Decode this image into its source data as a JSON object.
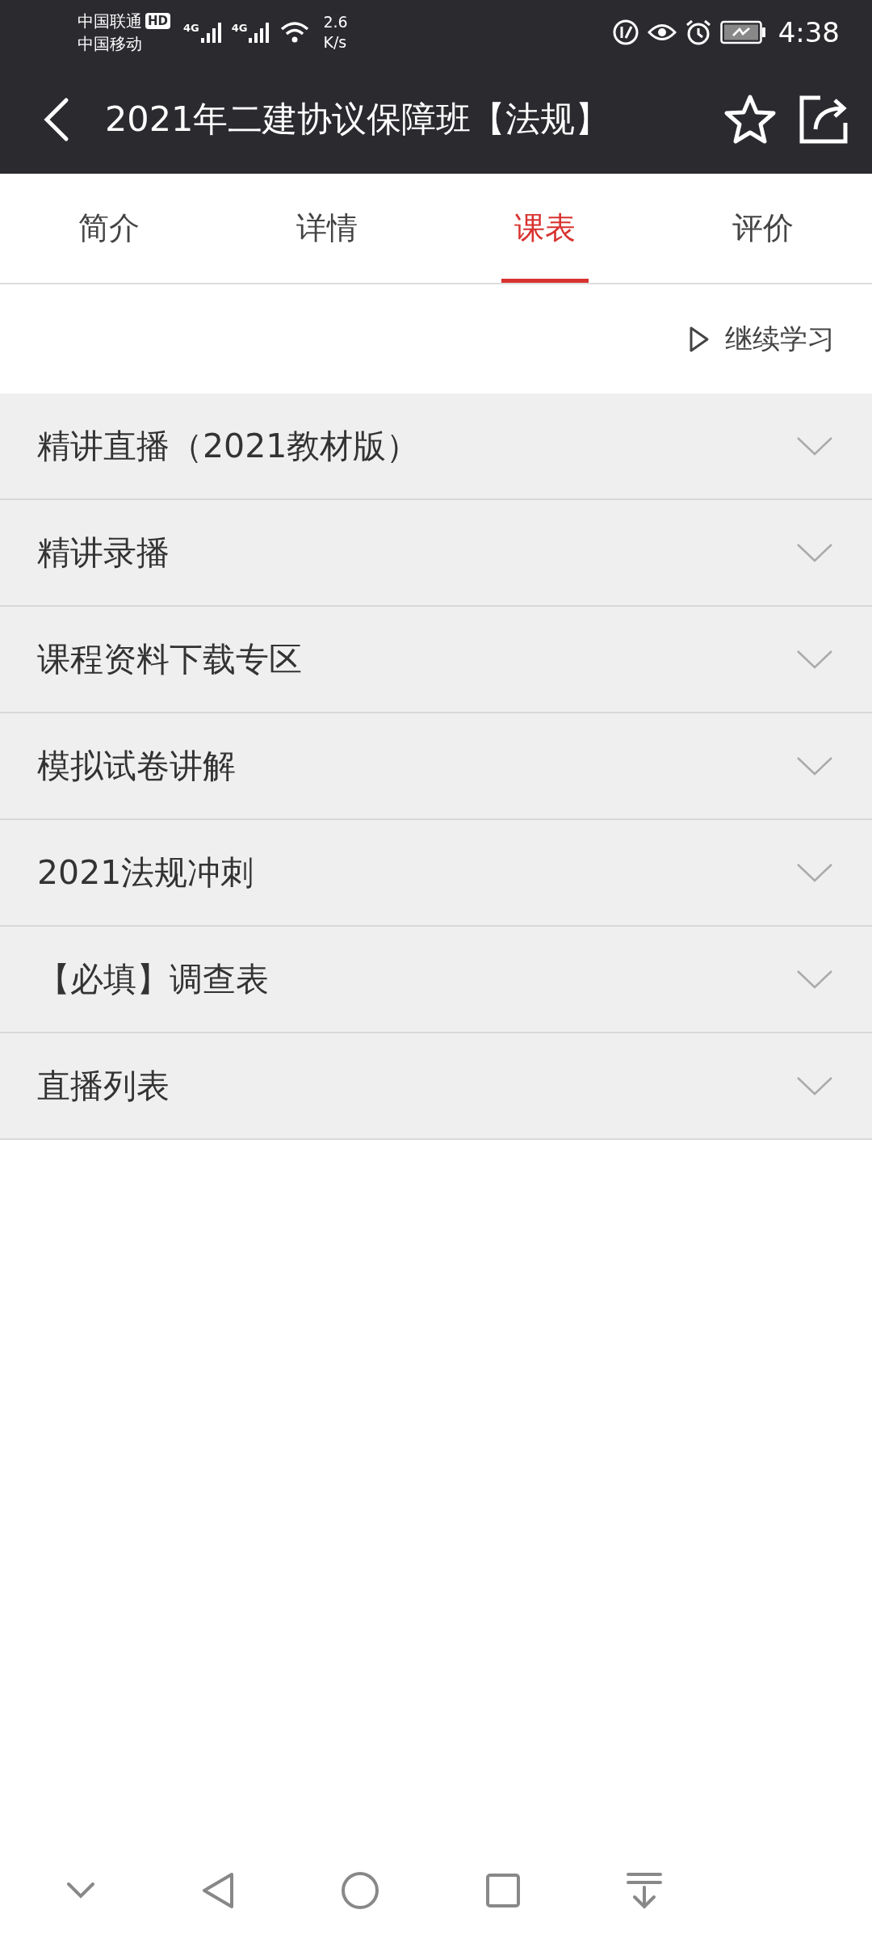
{
  "status_bar": {
    "carrier_1": "中国联通",
    "hd_badge": "HD",
    "carrier_2": "中国移动",
    "signal_1_label": "4G",
    "signal_2_label": "4G",
    "speed_value": "2.6",
    "speed_unit": "K/s",
    "time": "4:38"
  },
  "header": {
    "title": "2021年二建协议保障班【法规】"
  },
  "tabs": [
    {
      "label": "简介",
      "selected": false
    },
    {
      "label": "详情",
      "selected": false
    },
    {
      "label": "课表",
      "selected": true
    },
    {
      "label": "评价",
      "selected": false
    }
  ],
  "continue_button": {
    "label": "继续学习"
  },
  "sections": [
    {
      "title": "精讲直播（2021教材版）",
      "expanded": false
    },
    {
      "title": "精讲录播",
      "expanded": false
    },
    {
      "title": "课程资料下载专区",
      "expanded": false
    },
    {
      "title": "模拟试卷讲解",
      "expanded": false
    },
    {
      "title": "2021法规冲刺",
      "expanded": false
    },
    {
      "title": "【必填】调查表",
      "expanded": false
    },
    {
      "title": "直播列表",
      "expanded": false
    }
  ]
}
